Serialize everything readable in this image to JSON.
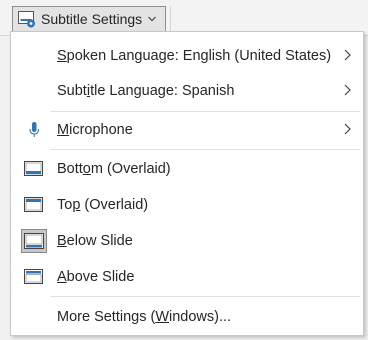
{
  "button": {
    "label": "Subtitle Settings",
    "icon": "subtitle-settings-icon",
    "chevron": "chevron-down-icon"
  },
  "menu": {
    "spoken_language": {
      "pre": "",
      "ul": "S",
      "post": "poken Language: English (United States)"
    },
    "subtitle_language": {
      "pre": "Subt",
      "ul": "i",
      "post": "tle Language: Spanish"
    },
    "microphone": {
      "pre": "",
      "ul": "M",
      "post": "icrophone"
    },
    "bottom": {
      "pre": "Bott",
      "ul": "o",
      "post": "m (Overlaid)"
    },
    "top": {
      "pre": "To",
      "ul": "p",
      "post": " (Overlaid)"
    },
    "below": {
      "pre": "",
      "ul": "B",
      "post": "elow Slide"
    },
    "above": {
      "pre": "",
      "ul": "A",
      "post": "bove Slide"
    },
    "more": {
      "pre": "More Settings (",
      "ul": "W",
      "post": "indows)..."
    }
  },
  "colors": {
    "accent": "#2e75b6",
    "light_accent": "#bdd7ee",
    "menu_bg": "#ffffff",
    "selected_bg": "#c7c7c7"
  }
}
